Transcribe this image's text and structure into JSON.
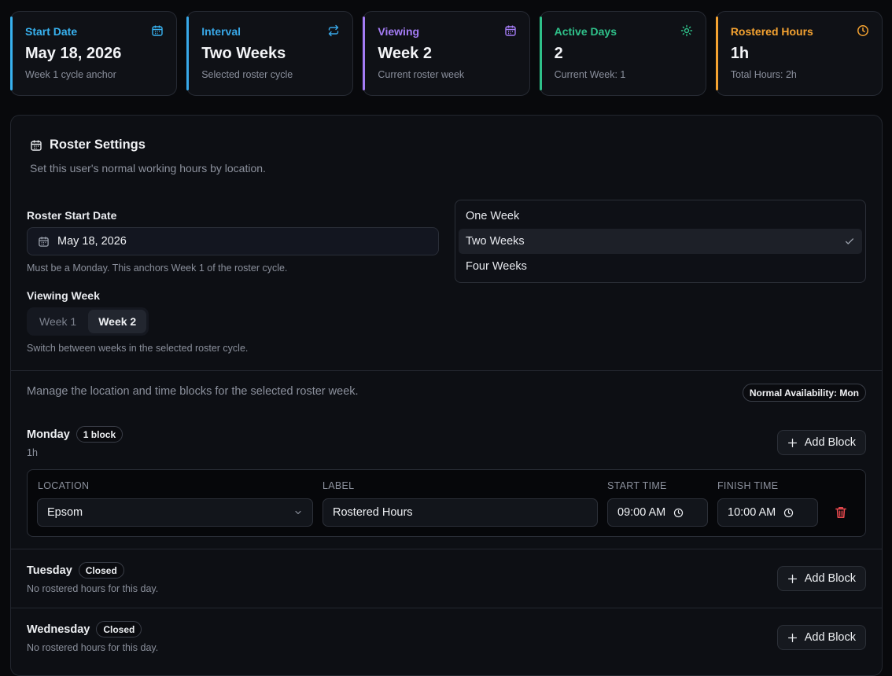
{
  "stats": [
    {
      "title": "Start Date",
      "value": "May 18, 2026",
      "sub": "Week 1 cycle anchor",
      "accent": "#38b2f0",
      "icon": "calendar-icon"
    },
    {
      "title": "Interval",
      "value": "Two Weeks",
      "sub": "Selected roster cycle",
      "accent": "#38a8e8",
      "icon": "repeat-icon"
    },
    {
      "title": "Viewing",
      "value": "Week 2",
      "sub": "Current roster week",
      "accent": "#a47cf5",
      "icon": "calendar-icon"
    },
    {
      "title": "Active Days",
      "value": "2",
      "sub": "Current Week: 1",
      "accent": "#2fc18a",
      "icon": "sun-icon"
    },
    {
      "title": "Rostered Hours",
      "value": "1h",
      "sub": "Total Hours: 2h",
      "accent": "#f5a331",
      "icon": "clock-icon"
    }
  ],
  "settings": {
    "title": "Roster Settings",
    "description": "Set this user's normal working hours by location.",
    "start_date_label": "Roster Start Date",
    "start_date_value": "May 18, 2026",
    "start_date_hint": "Must be a Monday. This anchors Week 1 of the roster cycle.",
    "viewing_week_label": "Viewing Week",
    "week_options": [
      "Week 1",
      "Week 2"
    ],
    "selected_week": "Week 2",
    "viewing_week_hint": "Switch between weeks in the selected roster cycle.",
    "interval_options": [
      "One Week",
      "Two Weeks",
      "Four Weeks"
    ],
    "selected_interval": "Two Weeks"
  },
  "manage": {
    "text": "Manage the location and time blocks for the selected roster week.",
    "availability_badge": "Normal Availability: Mon"
  },
  "days": [
    {
      "name": "Monday",
      "badge": "1 block",
      "sub": "1h",
      "add_label": "Add Block"
    },
    {
      "name": "Tuesday",
      "badge": "Closed",
      "sub": "No rostered hours for this day.",
      "add_label": "Add Block"
    },
    {
      "name": "Wednesday",
      "badge": "Closed",
      "sub": "No rostered hours for this day.",
      "add_label": "Add Block"
    }
  ],
  "block": {
    "location_label": "LOCATION",
    "location_value": "Epsom",
    "label_label": "LABEL",
    "label_value": "Rostered Hours",
    "start_label": "START TIME",
    "start_value": "09:00 AM",
    "finish_label": "FINISH TIME",
    "finish_value": "10:00 AM"
  },
  "colors": {
    "delete": "#e5484d"
  }
}
